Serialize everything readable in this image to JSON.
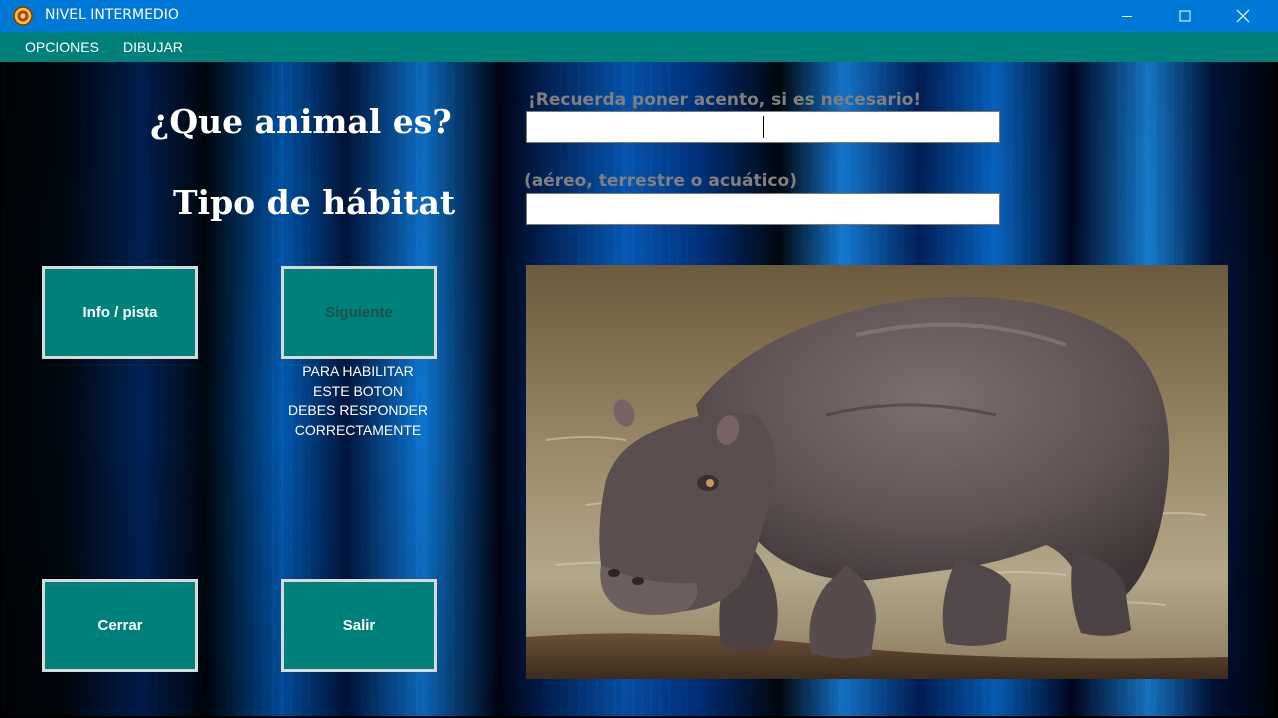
{
  "window": {
    "title": "NIVEL INTERMEDIO",
    "icon": "app-icon"
  },
  "menu": {
    "items": [
      "OPCIONES",
      "DIBUJAR"
    ]
  },
  "quiz": {
    "question_label": "¿Que animal es?",
    "habitat_label": "Tipo de hábitat",
    "answer_hint": "¡Recuerda poner acento, si es necesario!",
    "answer_value": "",
    "habitat_hint": "(aéreo, terrestre o acuático)",
    "habitat_value": ""
  },
  "buttons": {
    "info": "Info / pista",
    "next": "Siguiente",
    "close": "Cerrar",
    "exit": "Salir"
  },
  "next_note": "PARA HABILITAR\nESTE BOTON\nDEBES RESPONDER\nCORRECTAMENTE",
  "image": {
    "subject": "hippopotamus"
  },
  "colors": {
    "titlebar": "#0078d7",
    "menubar": "#00807a",
    "button_face": "#00807a",
    "button_border": "#d9d9d9",
    "hint_text": "#808080"
  }
}
